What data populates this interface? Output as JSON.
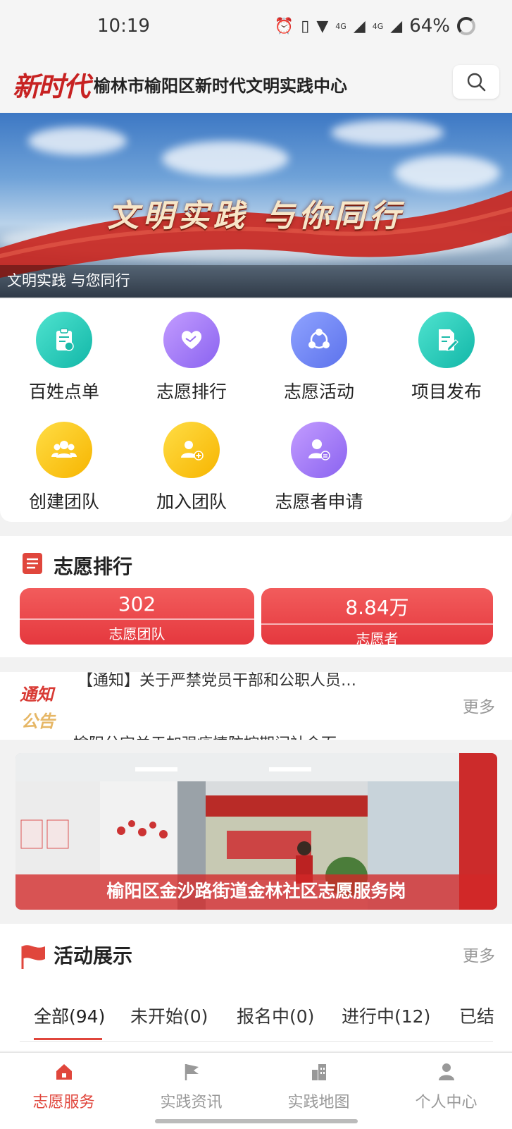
{
  "status_bar": {
    "time": "10:19",
    "network1": "4G",
    "network2": "4G",
    "battery": "64%"
  },
  "header": {
    "logo_text": "新时代",
    "title": "榆林市榆阳区新时代文明实践中心",
    "search_icon": "search-icon"
  },
  "banner": {
    "slogan": "文明实践 与你同行",
    "caption": "文明实践 与您同行"
  },
  "grid": [
    {
      "label": "百姓点单",
      "icon": "clipboard-check-icon",
      "color": "teal"
    },
    {
      "label": "志愿排行",
      "icon": "handshake-heart-icon",
      "color": "purple"
    },
    {
      "label": "志愿活动",
      "icon": "network-people-icon",
      "color": "blue"
    },
    {
      "label": "项目发布",
      "icon": "document-edit-icon",
      "color": "teal"
    },
    {
      "label": "创建团队",
      "icon": "group-icon",
      "color": "yellow"
    },
    {
      "label": "加入团队",
      "icon": "add-member-icon",
      "color": "yellow"
    },
    {
      "label": "志愿者申请",
      "icon": "person-apply-icon",
      "color": "purple"
    }
  ],
  "ranking": {
    "title": "志愿排行",
    "teams": {
      "value": "302",
      "label": "志愿团队"
    },
    "volunteers": {
      "value": "8.84万",
      "label": "志愿者"
    }
  },
  "notice": {
    "tag_top": "通知",
    "tag_bottom": "公告",
    "items": [
      "【通知】关于严禁党员干部和公职人员…",
      "榆阳分完关于加强疫情防控期间社会面"
    ],
    "more": "更多"
  },
  "photo": {
    "caption": "榆阳区金沙路街道金林社区志愿服务岗"
  },
  "activity": {
    "title": "活动展示",
    "more": "更多",
    "tabs": [
      "全部(94)",
      "未开始(0)",
      "报名中(0)",
      "进行中(12)",
      "已结"
    ]
  },
  "bottom_nav": [
    {
      "label": "志愿服务",
      "icon": "home-icon",
      "active": true
    },
    {
      "label": "实践资讯",
      "icon": "flag-icon",
      "active": false
    },
    {
      "label": "实践地图",
      "icon": "building-icon",
      "active": false
    },
    {
      "label": "个人中心",
      "icon": "person-icon",
      "active": false
    }
  ],
  "colors": {
    "accent": "#e0463c",
    "brand": "#c72222"
  }
}
